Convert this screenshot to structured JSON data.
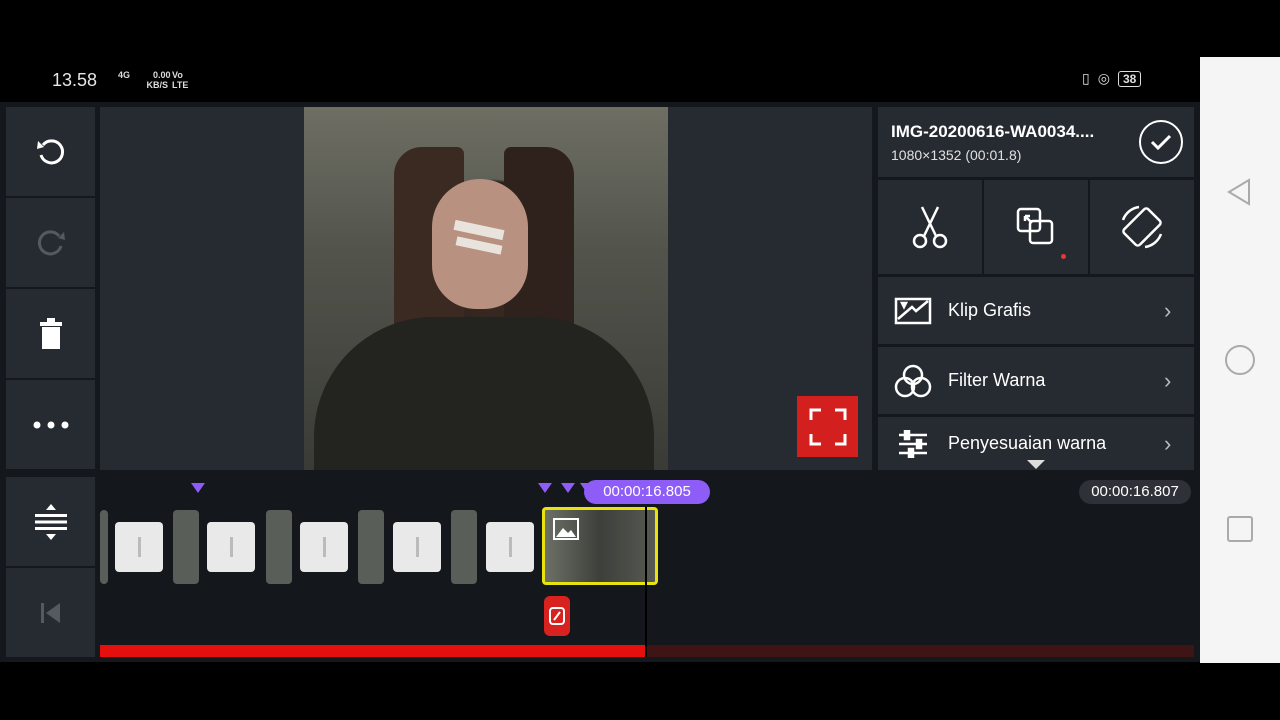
{
  "status": {
    "time": "13.58",
    "network_small": "4G",
    "speed": "0.00",
    "speed_unit": "KB/S",
    "carrier_top": "Vo",
    "carrier_bottom": "LTE",
    "battery": "38"
  },
  "clip": {
    "filename": "IMG-20200616-WA0034....",
    "meta": "1080×1352 (00:01.8)"
  },
  "menu": [
    {
      "label": "Klip Grafis",
      "icon": "graphic-clip-icon"
    },
    {
      "label": "Filter Warna",
      "icon": "color-filter-icon"
    },
    {
      "label": "Penyesuaian warna",
      "icon": "color-adjust-icon"
    }
  ],
  "timeline": {
    "playhead_time": "00:00:16.805",
    "total_time": "00:00:16.807",
    "progress_fraction": 0.498
  },
  "colors": {
    "accent": "#8e5cf7",
    "record": "#e5100e",
    "selection": "#e8e30c"
  }
}
